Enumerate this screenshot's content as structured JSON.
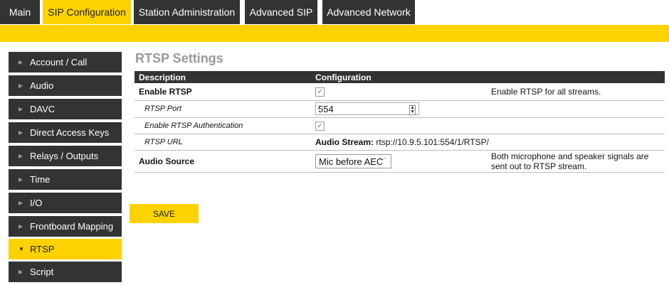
{
  "tabs": [
    "Main",
    "SIP Configuration",
    "Station Administration",
    "Advanced SIP",
    "Advanced Network"
  ],
  "sidebar": [
    "Account / Call",
    "Audio",
    "DAVC",
    "Direct Access Keys",
    "Relays / Outputs",
    "Time",
    "I/O",
    "Frontboard Mapping",
    "RTSP",
    "Script"
  ],
  "title": "RTSP Settings",
  "table": {
    "headers": [
      "Description",
      "Configuration"
    ],
    "enable_rtsp": {
      "label": "Enable RTSP",
      "checked": true,
      "help": "Enable RTSP for all streams."
    },
    "port": {
      "label": "RTSP Port",
      "value": "554"
    },
    "auth": {
      "label": "Enable RTSP Authentication",
      "checked": true
    },
    "url": {
      "label": "RTSP URL",
      "prefix": "Audio Stream:",
      "value": "rtsp://10.9.5.101:554/1/RTSP/"
    },
    "audio_source": {
      "label": "Audio Source",
      "value": "Mic before AEC",
      "help": "Both microphone and speaker signals are sent out to RTSP stream."
    }
  },
  "save_label": "SAVE",
  "colors": {
    "accent": "#fcd200",
    "dark": "#333333"
  }
}
